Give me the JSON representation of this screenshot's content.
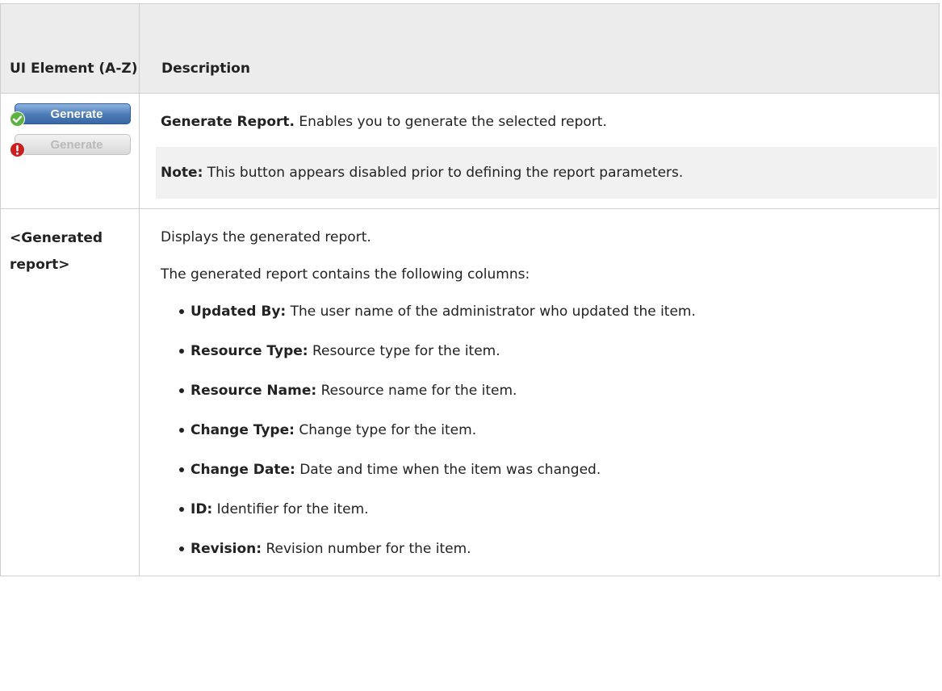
{
  "table": {
    "header": {
      "col1": "UI Element (A-Z)",
      "col2": "Description"
    },
    "rows": [
      {
        "element": {
          "buttons": [
            {
              "label": "Generate",
              "state": "enabled",
              "badge_icon": "check-icon",
              "badge_color": "#5db33f"
            },
            {
              "label": "Generate",
              "state": "disabled",
              "badge_icon": "exclamation-icon",
              "badge_color": "#cc1f1f"
            }
          ]
        },
        "desc_title": "Generate Report.",
        "desc_text": " Enables you to generate the selected report.",
        "note_label": "Note:",
        "note_text": " This button appears disabled prior to defining the report parameters."
      },
      {
        "element_label": "<Generated report>",
        "desc_intro": "Displays the generated report.",
        "desc_columns_intro": "The generated report contains the following columns:",
        "columns": [
          {
            "term": "Updated By:",
            "text": " The user name of the administrator who updated the item."
          },
          {
            "term": "Resource Type:",
            "text": " Resource type for the item."
          },
          {
            "term": "Resource Name:",
            "text": " Resource name for the item."
          },
          {
            "term": "Change Type:",
            "text": " Change type for the item."
          },
          {
            "term": "Change Date:",
            "text": " Date and time when the item was changed."
          },
          {
            "term": "ID:",
            "text": " Identifier for the item."
          },
          {
            "term": "Revision:",
            "text": " Revision number for the item."
          }
        ]
      }
    ]
  }
}
